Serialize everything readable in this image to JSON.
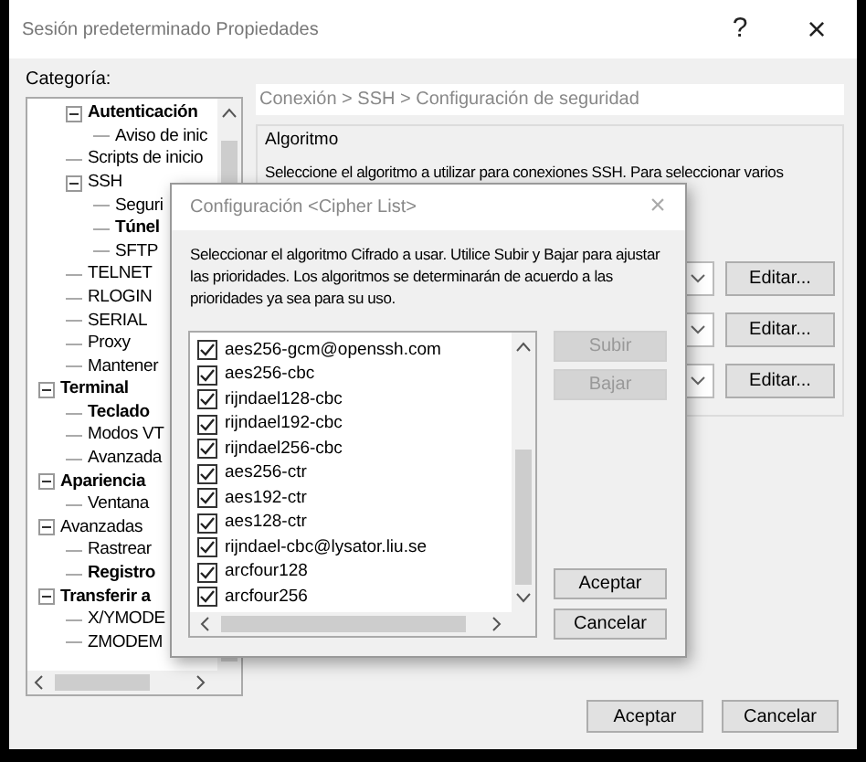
{
  "window": {
    "title": "Sesión predeterminado Propiedades",
    "help": "?",
    "close": "×"
  },
  "category_label": "Categoría:",
  "tree": {
    "items": [
      {
        "children": [
          {
            "label": "Autenticación",
            "emphasized": true,
            "expanded": true,
            "children": [
              {
                "label": "Aviso de inic",
                "emphasized": false
              }
            ]
          },
          {
            "label": "Scripts de inicio",
            "emphasized": false
          },
          {
            "label": "SSH",
            "emphasized": false,
            "expanded": true,
            "children": [
              {
                "label": "Seguri",
                "emphasized": false
              },
              {
                "label": "Túnel",
                "emphasized": true
              },
              {
                "label": "SFTP",
                "emphasized": false
              }
            ]
          },
          {
            "label": "TELNET",
            "emphasized": false
          },
          {
            "label": "RLOGIN",
            "emphasized": false
          },
          {
            "label": "SERIAL",
            "emphasized": false
          },
          {
            "label": "Proxy",
            "emphasized": false
          },
          {
            "label": "Mantener",
            "emphasized": false
          }
        ]
      },
      {
        "label": "Terminal",
        "emphasized": true,
        "expanded": true,
        "children": [
          {
            "label": "Teclado",
            "emphasized": true
          },
          {
            "label": "Modos VT",
            "emphasized": false
          },
          {
            "label": "Avanzada",
            "emphasized": false
          }
        ]
      },
      {
        "label": "Apariencia",
        "emphasized": true,
        "expanded": true,
        "children": [
          {
            "label": "Ventana",
            "emphasized": false
          }
        ]
      },
      {
        "label": "Avanzadas",
        "emphasized": false,
        "expanded": true,
        "children": [
          {
            "label": "Rastrear",
            "emphasized": false
          },
          {
            "label": "Registro",
            "emphasized": true
          }
        ]
      },
      {
        "label": "Transferir a",
        "emphasized": true,
        "expanded": true,
        "children": [
          {
            "label": "X/YMODE",
            "emphasized": false
          },
          {
            "label": "ZMODEM",
            "emphasized": false
          }
        ]
      }
    ]
  },
  "breadcrumb": "Conexión > SSH > Configuración de seguridad",
  "group": {
    "title": "Algoritmo",
    "description": "Seleccione el algoritmo a utilizar para conexiones SSH. Para seleccionar varios",
    "edit_buttons": [
      "Editar...",
      "Editar...",
      "Editar..."
    ]
  },
  "dialog": {
    "title": "Configuración <Cipher List>",
    "close": "×",
    "description": "Seleccionar el algoritmo Cifrado a usar. Utilice Subir y Bajar para ajustar las prioridades. Los algoritmos se determinarán de acuerdo a las prioridades ya sea para su uso.",
    "ciphers": [
      {
        "label": "aes256-gcm@openssh.com",
        "checked": true
      },
      {
        "label": "aes256-cbc",
        "checked": true
      },
      {
        "label": "rijndael128-cbc",
        "checked": true
      },
      {
        "label": "rijndael192-cbc",
        "checked": true
      },
      {
        "label": "rijndael256-cbc",
        "checked": true
      },
      {
        "label": "aes256-ctr",
        "checked": true
      },
      {
        "label": "aes192-ctr",
        "checked": true
      },
      {
        "label": "aes128-ctr",
        "checked": true
      },
      {
        "label": "rijndael-cbc@lysator.liu.se",
        "checked": true
      },
      {
        "label": "arcfour128",
        "checked": true
      },
      {
        "label": "arcfour256",
        "checked": true
      }
    ],
    "buttons": [
      {
        "label": "Subir",
        "disabled": true
      },
      {
        "label": "Bajar",
        "disabled": true
      },
      {
        "label": "Aceptar",
        "disabled": false
      },
      {
        "label": "Cancelar",
        "disabled": false
      }
    ]
  },
  "buttons": [
    "Aceptar",
    "Cancelar"
  ]
}
